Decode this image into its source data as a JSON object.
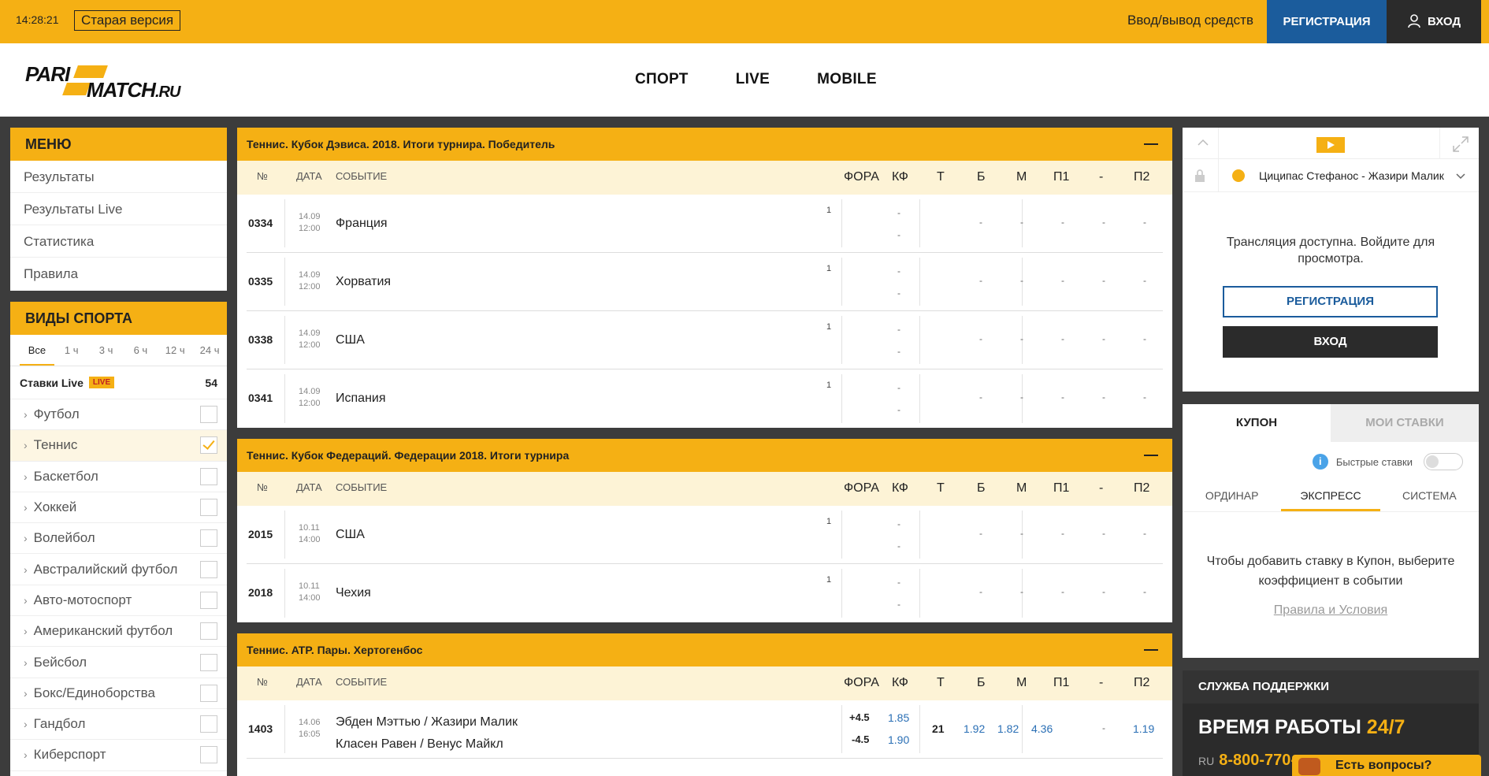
{
  "topbar": {
    "time": "14:28:21",
    "old_version": "Старая версия",
    "funds": "Ввод/вывод средств",
    "register": "РЕГИСТРАЦИЯ",
    "login": "ВХОД"
  },
  "logo": {
    "line1": "PARI",
    "line2": "MATCH",
    "suffix": ".RU"
  },
  "nav": [
    "СПОРТ",
    "LIVE",
    "MOBILE"
  ],
  "menu": {
    "title": "МЕНЮ",
    "items": [
      "Результаты",
      "Результаты Live",
      "Статистика",
      "Правила"
    ]
  },
  "sports": {
    "title": "ВИДЫ СПОРТА",
    "filters": [
      "Все",
      "1 ч",
      "3 ч",
      "6 ч",
      "12 ч",
      "24 ч"
    ],
    "live_label": "Ставки Live",
    "live_badge": "LIVE",
    "live_count": "54",
    "items": [
      "Футбол",
      "Теннис",
      "Баскетбол",
      "Хоккей",
      "Волейбол",
      "Австралийский футбол",
      "Авто-мотоспорт",
      "Американский футбол",
      "Бейсбол",
      "Бокс/Единоборства",
      "Гандбол",
      "Киберспорт"
    ]
  },
  "columns": {
    "num": "№",
    "date": "ДАТА",
    "event": "СОБЫТИЕ",
    "fora": "ФОРА",
    "kf": "КФ",
    "t": "Т",
    "b": "Б",
    "m": "М",
    "p1": "П1",
    "dash": "-",
    "p2": "П2"
  },
  "events": [
    {
      "title": "Теннис. Кубок Дэвиса. 2018. Итоги турнира. Победитель",
      "rows": [
        {
          "num": "0334",
          "date": "14.09",
          "time": "12:00",
          "name": "Франция",
          "one": "1"
        },
        {
          "num": "0335",
          "date": "14.09",
          "time": "12:00",
          "name": "Хорватия",
          "one": "1"
        },
        {
          "num": "0338",
          "date": "14.09",
          "time": "12:00",
          "name": "США",
          "one": "1"
        },
        {
          "num": "0341",
          "date": "14.09",
          "time": "12:00",
          "name": "Испания",
          "one": "1"
        }
      ]
    },
    {
      "title": "Теннис. Кубок Федераций. Федерации 2018. Итоги турнира",
      "rows": [
        {
          "num": "2015",
          "date": "10.11",
          "time": "14:00",
          "name": "США",
          "one": "1"
        },
        {
          "num": "2018",
          "date": "10.11",
          "time": "14:00",
          "name": "Чехия",
          "one": "1"
        }
      ]
    },
    {
      "title": "Теннис. ATP. Пары. Хертогенбос",
      "rows": [
        {
          "num": "1403",
          "date": "14.06",
          "time": "16:05",
          "name1": "Эбден Мэттью / Жазири Малик",
          "name2": "Класен Равен / Венус Майкл",
          "fora1": "+4.5",
          "fora2": "-4.5",
          "kf1": "1.85",
          "kf2": "1.90",
          "t": "21",
          "b": "1.92",
          "m": "1.82",
          "p1": "4.36",
          "dash": "-",
          "p2": "1.19"
        }
      ]
    }
  ],
  "video": {
    "match": "Циципас Стефанос - Жазири Малик",
    "text": "Трансляция доступна. Войдите для просмотра.",
    "register": "РЕГИСТРАЦИЯ",
    "login": "ВХОД"
  },
  "coupon": {
    "tab1": "КУПОН",
    "tab2": "МОИ СТАВКИ",
    "fast_bets": "Быстрые ставки",
    "types": [
      "ОРДИНАР",
      "ЭКСПРЕСС",
      "СИСТЕМА"
    ],
    "hint": "Чтобы добавить ставку в Купон, выберите коэффициент в событии",
    "rules": "Правила и Условия"
  },
  "support": {
    "title": "СЛУЖБА ПОДДЕРЖКИ",
    "hours_label": "ВРЕМЯ РАБОТЫ",
    "hours": "24/7",
    "country": "RU",
    "phone": "8-800-770-"
  },
  "chat": "Есть вопросы?",
  "colors": {
    "accent": "#f5b014",
    "register_blue": "#1b5c9c",
    "dark": "#2b2b2b"
  }
}
